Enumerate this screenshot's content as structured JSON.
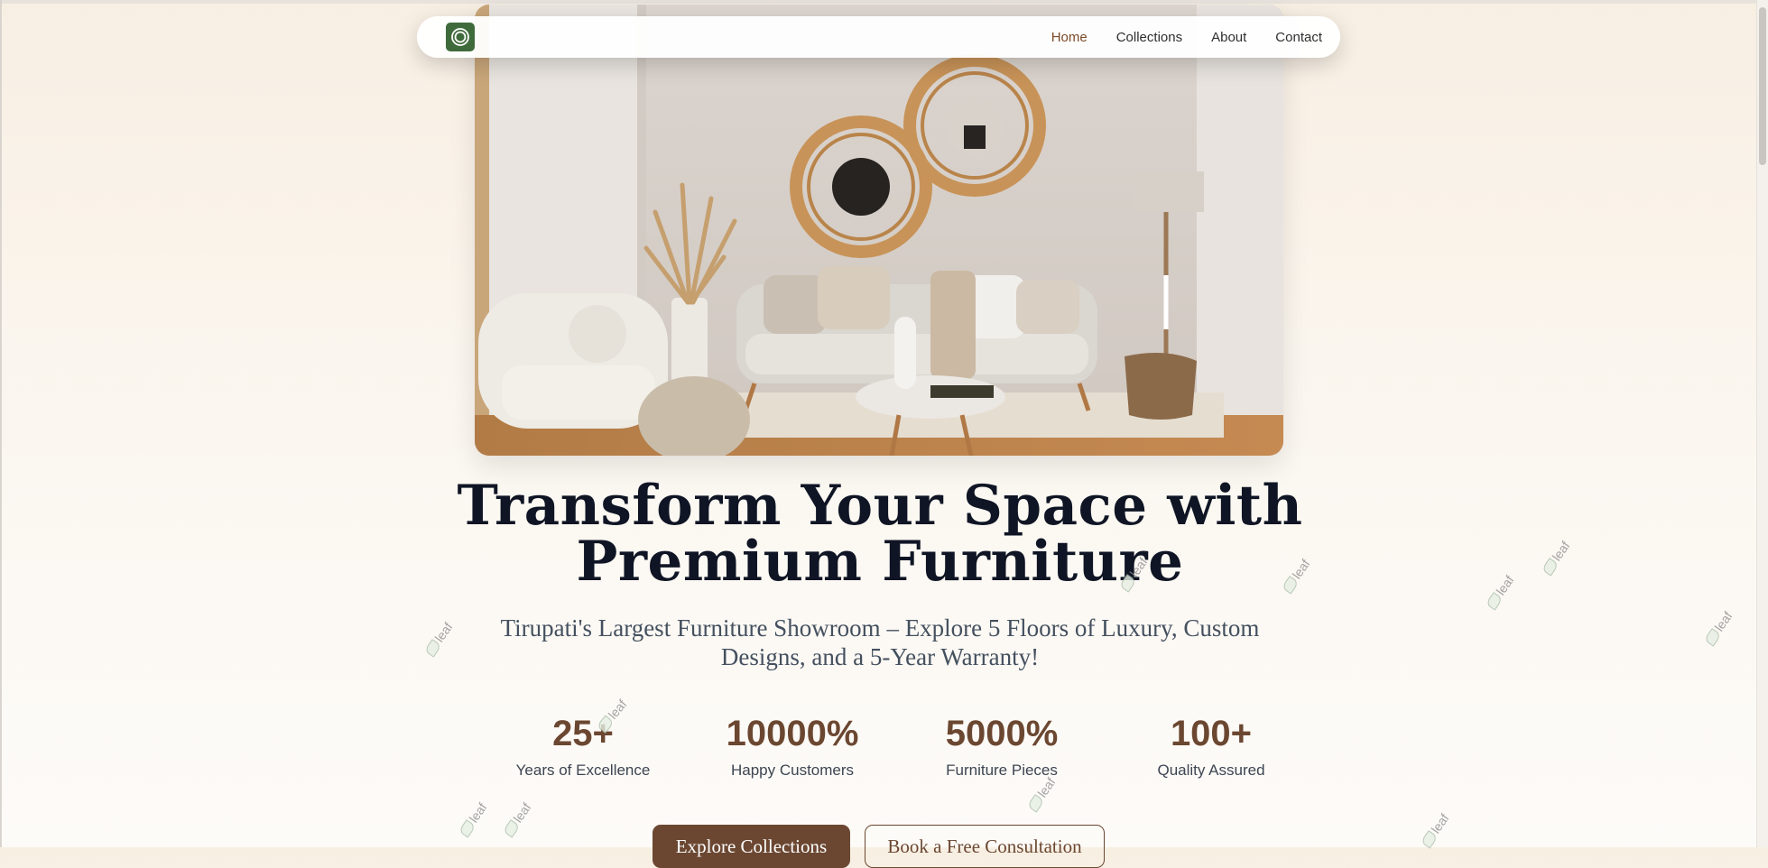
{
  "nav": {
    "logo_icon": "target-ring-icon",
    "links": [
      "Home",
      "Collections",
      "About",
      "Contact"
    ],
    "active": "Home"
  },
  "hero": {
    "image_icon": "living-room-photo",
    "title_line1": "Transform Your Space with",
    "title_line2": "Premium Furniture",
    "subtitle": "Tirupati's Largest Furniture Showroom – Explore 5 Floors of Luxury, Custom Designs, and a 5-Year Warranty!"
  },
  "stats": [
    {
      "value": "25+",
      "label": "Years of Excellence"
    },
    {
      "value": "10000%",
      "label": "Happy Customers"
    },
    {
      "value": "5000%",
      "label": "Furniture Pieces"
    },
    {
      "value": "100+",
      "label": "Quality Assured"
    }
  ],
  "buttons": {
    "primary": "Explore Collections",
    "secondary": "Book a Free Consultation"
  },
  "decor": {
    "leaf_text": "leaf"
  },
  "colors": {
    "brand_brown": "#6b4731",
    "logo_green": "#3f6a3b",
    "title_navy": "#0f1524"
  }
}
